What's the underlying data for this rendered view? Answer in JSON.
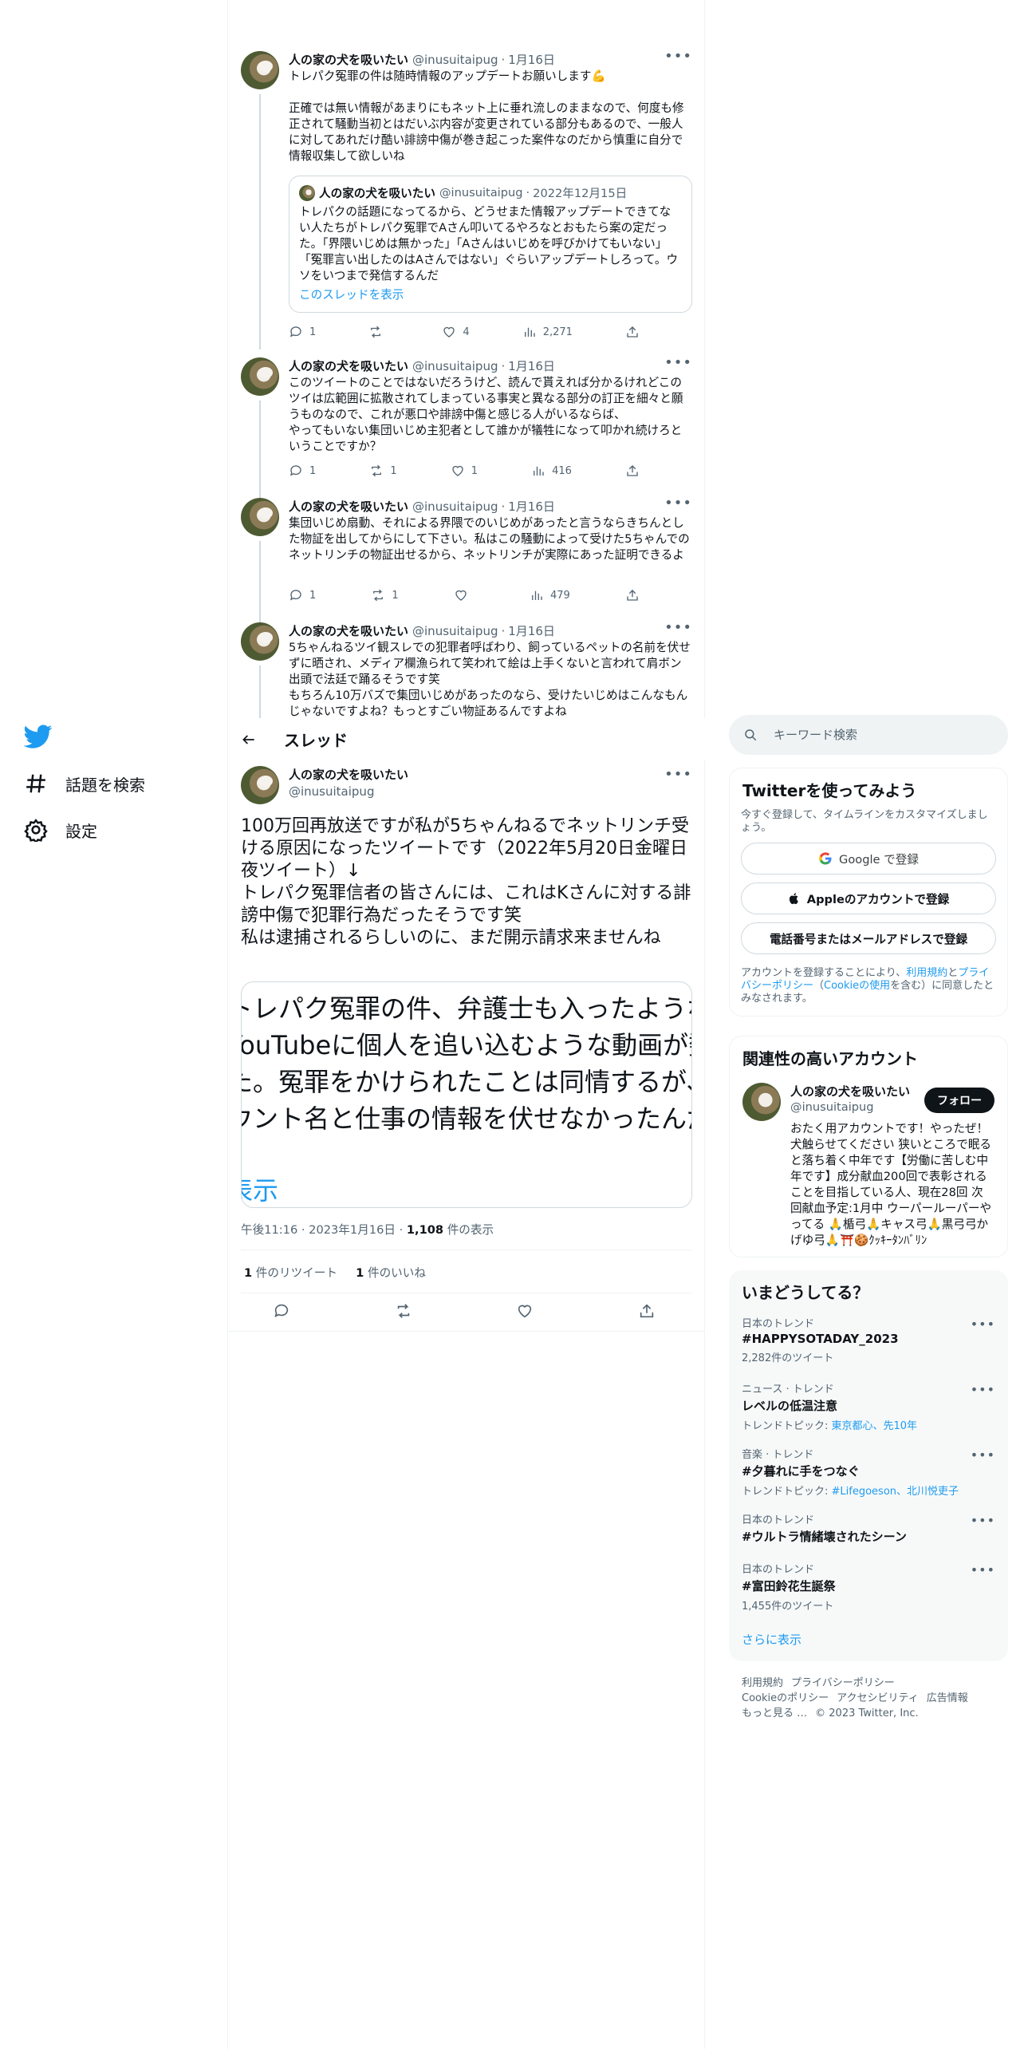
{
  "nav": {
    "items": [
      {
        "label": "話題を検索",
        "icon": "hashtag-icon"
      },
      {
        "label": "設定",
        "icon": "gear-icon"
      }
    ]
  },
  "thread_tweets": [
    {
      "name": "人の家の犬を吸いたい",
      "handle": "@inusuitaipug",
      "date": "1月16日",
      "body": "トレパク冤罪の件は随時情報のアップデートお願いします💪\n\n正確では無い情報があまりにもネット上に垂れ流しのままなので、何度も修正されて騒動当初とはだいぶ内容が変更されている部分もあるので、一般人に対してあれだけ酷い誹謗中傷が巻き起こった案件なのだから慎重に自分で情報収集して欲しいね",
      "quote": {
        "name": "人の家の犬を吸いたい",
        "handle": "@inusuitaipug",
        "date": "2022年12月15日",
        "body": "トレパクの話題になってるから、どうせまた情報アップデートできてない人たちがトレパク冤罪でAさん叩いてるやろなとおもたら案の定だった。「界隈いじめは無かった」「Aさんはいじめを呼びかけてもいない」「冤罪言い出したのはAさんではない」ぐらいアップデートしろって。ウソをいつまで発信するんだ",
        "link": "このスレッドを表示"
      },
      "replies": "1",
      "retweets": "",
      "likes": "4",
      "views": "2,271"
    },
    {
      "name": "人の家の犬を吸いたい",
      "handle": "@inusuitaipug",
      "date": "1月16日",
      "body": "このツイートのことではないだろうけど、読んで貰えれば分かるけれどこのツイは広範囲に拡散されてしまっている事実と異なる部分の訂正を細々と願うものなので、これが悪口や誹謗中傷と感じる人がいるならば、\nやってもいない集団いじめ主犯者として誰かが犠牲になって叩かれ続けろということですか？",
      "replies": "1",
      "retweets": "1",
      "likes": "1",
      "views": "416"
    },
    {
      "name": "人の家の犬を吸いたい",
      "handle": "@inusuitaipug",
      "date": "1月16日",
      "body": "集団いじめ扇動、それによる界隈でのいじめがあったと言うならきちんとした物証を出してからにして下さい。私はこの騒動によって受けた5ちゃんでのネットリンチの物証出せるから、ネットリンチが実際にあった証明できるよ",
      "replies": "1",
      "retweets": "1",
      "likes": "",
      "views": "479"
    },
    {
      "name": "人の家の犬を吸いたい",
      "handle": "@inusuitaipug",
      "date": "1月16日",
      "body": "5ちゃんねるツイ観スレでの犯罪者呼ばわり、飼っているペットの名前を伏せずに晒され、メディア欄漁られて笑われて絵は上手くないと言われて肩ボン出頭で法廷で踊るそうです笑\nもちろん10万バズで集団いじめがあったのなら、受けたいじめはこんなもんじゃないですよね？もっとすごい物証あるんですよね"
    }
  ],
  "header": {
    "title": "スレッド"
  },
  "main_tweet": {
    "name": "人の家の犬を吸いたい",
    "handle": "@inusuitaipug",
    "body": "100万回再放送ですが私が5ちゃんねるでネットリンチ受ける原因になったツイートです（2022年5月20日金曜日夜ツイート）↓\nトレパク冤罪信者の皆さんには、これはKさんに対する誹謗中傷で犯罪行為だったそうです笑\n私は逮捕されるらしいのに、まだ開示請求来ませんね",
    "quote_lines": [
      "トレパク冤罪の件、弁護士も入ったようなの",
      "YouTubeに個人を追い込むような動画が数",
      "た。冤罪をかけられたことは同情するが、n",
      "ウント名と仕事の情報を伏せなかったんだ。"
    ],
    "quote_link": "表示",
    "time": "午後11:16",
    "date": "2023年1月16日",
    "views_count": "1,108",
    "views_label": "件の表示",
    "retweet_count": "1",
    "retweet_label": "件のリツイート",
    "like_count": "1",
    "like_label": "件のいいね"
  },
  "search": {
    "placeholder": "キーワード検索"
  },
  "signup": {
    "title": "Twitterを使ってみよう",
    "subtitle": "今すぐ登録して、タイムラインをカスタマイズしましょう。",
    "google_label": "Google で登録",
    "apple_label": "Appleのアカウントで登録",
    "phone_label": "電話番号またはメールアドレスで登録",
    "legal_prefix": "アカウントを登録することにより、",
    "legal_link1": "利用規約",
    "legal_and": "と",
    "legal_link2": "プライバシーポリシー",
    "legal_paren_open": "（",
    "legal_link3": "Cookieの使用",
    "legal_suffix": "を含む）に同意したとみなされます。"
  },
  "related": {
    "title": "関連性の高いアカウント",
    "name": "人の家の犬を吸いたい",
    "handle": "@inusuitaipug",
    "follow_label": "フォロー",
    "bio": "おたく用アカウントです！やったぜ！犬触らせてください 狭いところで眠ると落ち着く中年です【労働に苦しむ中年です】成分献血200回で表彰されることを目指している人、現在28回 次回献血予定:1月中 ウーパールーパーやってる 🙏楯弓🙏キャス弓🙏黒弓弓かげゆ弓🙏⛩️🍪ｸｯｷｰﾀﾝﾊﾞﾘﾝ"
  },
  "trends": {
    "title": "いまどうしてる？",
    "items": [
      {
        "category": "日本のトレンド",
        "name": "#HAPPYSOTADAY_2023",
        "sub": "2,282件のツイート"
      },
      {
        "category": "ニュース · トレンド",
        "name": "レベルの低温注意",
        "sub_prefix": "トレンドトピック: ",
        "sub_link": "東京都心、先10年"
      },
      {
        "category": "音楽 · トレンド",
        "name": "#夕暮れに手をつなぐ",
        "sub_prefix": "トレンドトピック: ",
        "sub_link": "#Lifegoeson、北川悦吏子"
      },
      {
        "category": "日本のトレンド",
        "name": "#ウルトラ情緒壊されたシーン",
        "sub": ""
      },
      {
        "category": "日本のトレンド",
        "name": "#富田鈴花生誕祭",
        "sub": "1,455件のツイート"
      }
    ],
    "show_more": "さらに表示"
  },
  "footer": {
    "links": [
      "利用規約",
      "プライバシーポリシー",
      "Cookieのポリシー",
      "アクセシビリティ",
      "広告情報",
      "もっと見る …"
    ],
    "copyright": "© 2023 Twitter, Inc."
  },
  "colors": {
    "accent": "#1d9bf0",
    "text": "#0f1419",
    "secondary": "#536471",
    "border": "#eff3f4"
  }
}
